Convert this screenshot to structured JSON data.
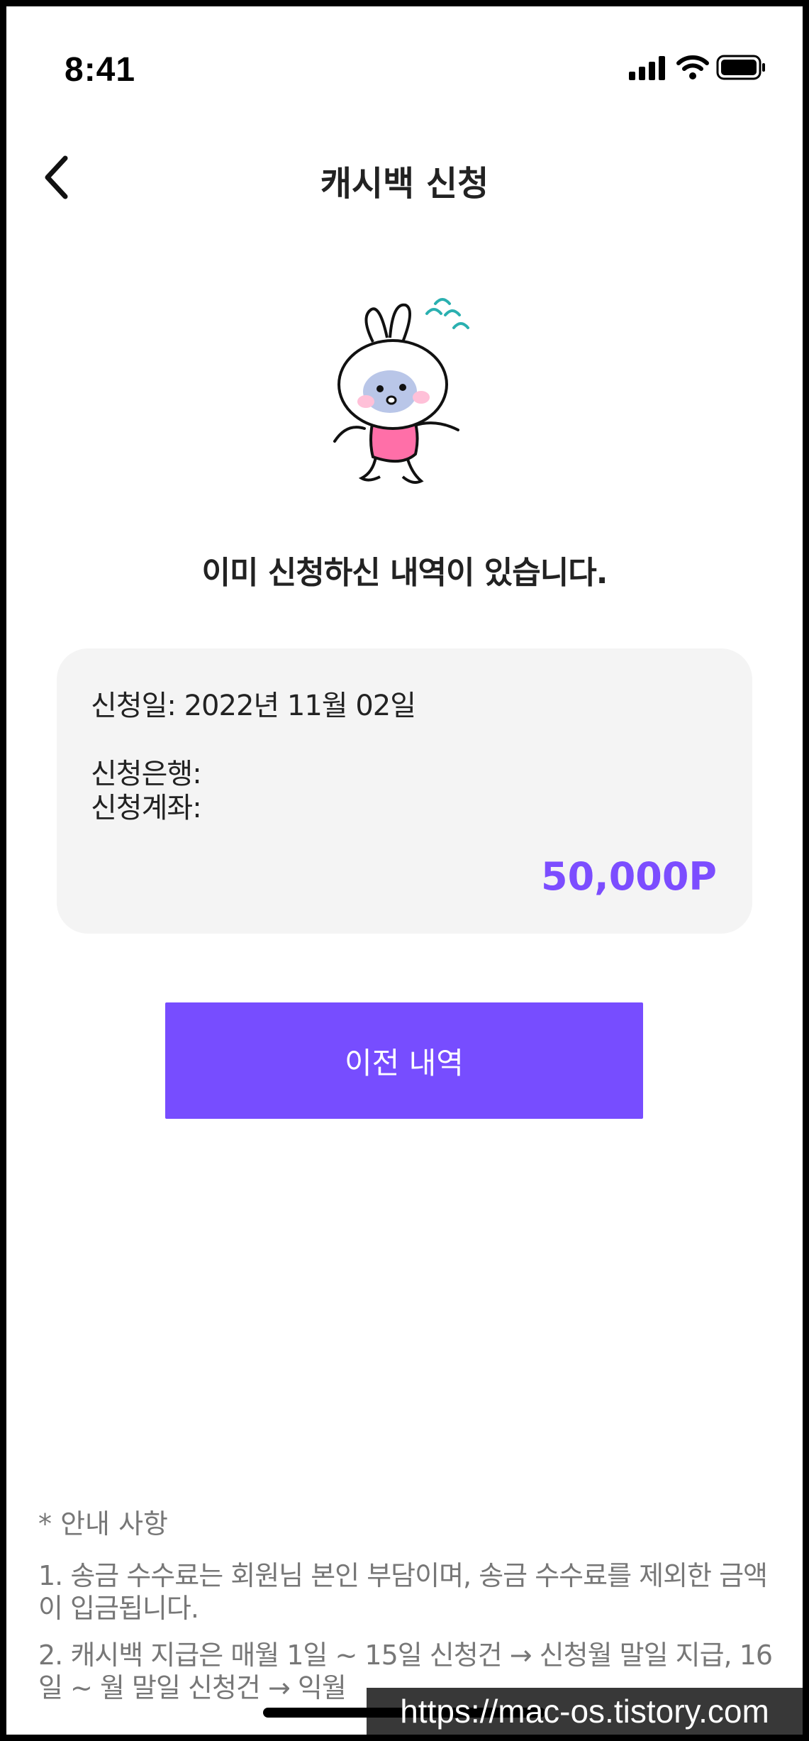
{
  "status_bar": {
    "time": "8:41",
    "icons": [
      "signal-icon",
      "wifi-icon",
      "battery-icon"
    ]
  },
  "nav": {
    "back_icon": "chevron-left-icon",
    "title": "캐시백 신청"
  },
  "illustration": {
    "icon": "bunny-sweating-illustration"
  },
  "headline": "이미 신청하신 내역이 있습니다.",
  "info_card": {
    "date_line": "신청일: 2022년 11월 02일",
    "bank_line": "신청은행:",
    "account_line": "신청계좌:",
    "amount": "50,000P"
  },
  "history_button": {
    "label": "이전 내역"
  },
  "notice": {
    "title": "* 안내 사항",
    "items": [
      "1. 송금 수수료는 회원님 본인 부담이며, 송금 수수료를 제외한 금액이 입금됩니다.",
      "2. 캐시백 지급은 매월 1일 ~ 15일 신청건 → 신청월 말일 지급, 16일 ~ 월 말일 신청건 → 익월"
    ]
  },
  "watermark": "https://mac-os.tistory.com",
  "colors": {
    "accent": "#774dff",
    "amount": "#7c4dff",
    "card_bg": "#f4f4f4",
    "notice_text": "#777777"
  }
}
